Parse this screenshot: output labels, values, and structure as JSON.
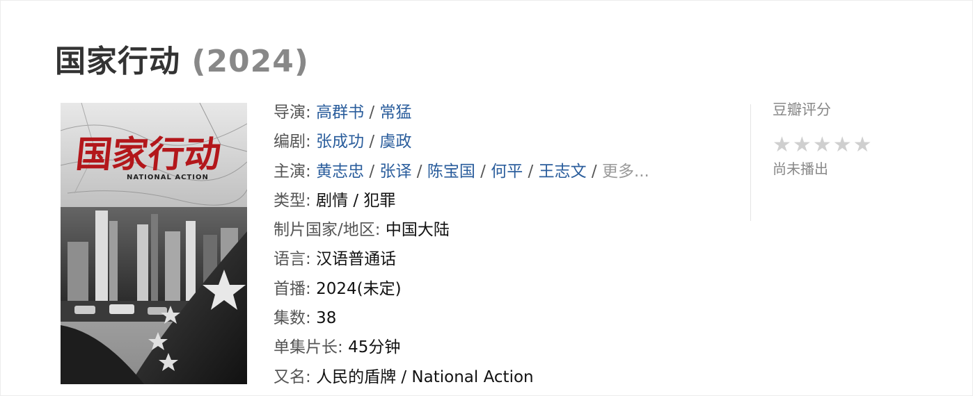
{
  "movie": {
    "title": "国家行动",
    "year": "(2024)"
  },
  "poster": {
    "title_art": "国家行动",
    "subtitle_art": "NATIONAL ACTION"
  },
  "info": {
    "director_label": "导演:",
    "directors": [
      "高群书",
      "常猛"
    ],
    "writer_label": "编剧:",
    "writers": [
      "张成功",
      "虞政"
    ],
    "cast_label": "主演:",
    "cast": [
      "黄志忠",
      "张译",
      "陈宝国",
      "何平",
      "王志文"
    ],
    "cast_more": "更多...",
    "genre_label": "类型:",
    "genre": "剧情 / 犯罪",
    "country_label": "制片国家/地区:",
    "country": "中国大陆",
    "language_label": "语言:",
    "language": "汉语普通话",
    "premiere_label": "首播:",
    "premiere": "2024(未定)",
    "episodes_label": "集数:",
    "episodes": "38",
    "runtime_label": "单集片长:",
    "runtime": "45分钟",
    "aka_label": "又名:",
    "aka": "人民的盾牌 / National Action",
    "separator": "/"
  },
  "rating": {
    "label": "豆瓣评分",
    "stars": 0,
    "status": "尚未播出"
  },
  "colors": {
    "link": "#2a5d9c",
    "title": "#333333",
    "muted": "#888888",
    "star_empty": "#cfcfcf"
  }
}
